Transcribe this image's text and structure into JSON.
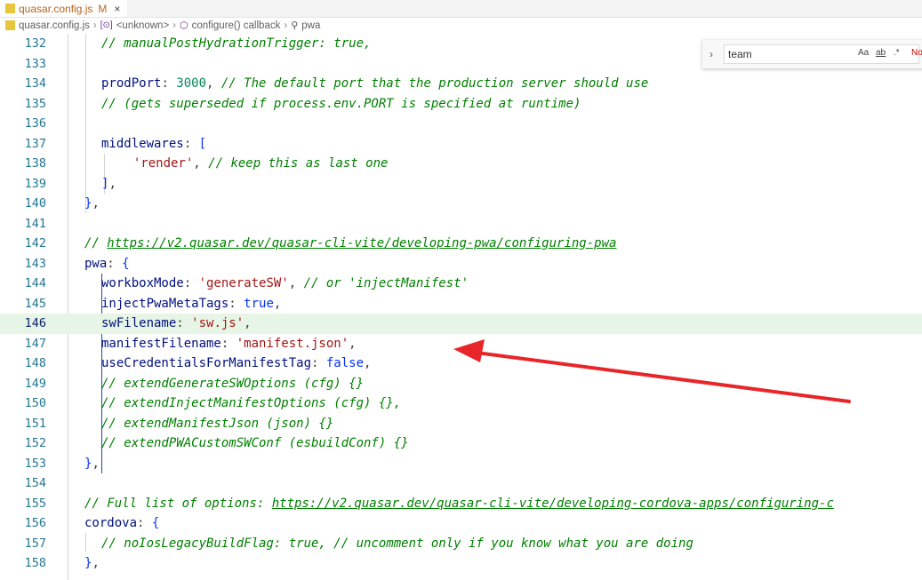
{
  "tab": {
    "filename": "quasar.config.js",
    "modified": "M",
    "close": "×"
  },
  "breadcrumb": {
    "items": [
      "quasar.config.js",
      "<unknown>",
      "configure() callback",
      "pwa"
    ]
  },
  "find": {
    "value": "team",
    "opt_case": "Aa",
    "opt_word": "ab",
    "opt_regex": ".*",
    "result": "No"
  },
  "lines": [
    {
      "n": "132",
      "tokens": [
        [
          "c",
          "// manualPostHydrationTrigger: true,"
        ]
      ]
    },
    {
      "n": "133",
      "tokens": []
    },
    {
      "n": "134",
      "tokens": [
        [
          "k",
          "prodPort"
        ],
        [
          "p",
          ": "
        ],
        [
          "n",
          "3000"
        ],
        [
          "p",
          ", "
        ],
        [
          "c",
          "// The default port that the production server should use"
        ]
      ]
    },
    {
      "n": "135",
      "tokens": [
        [
          "c",
          "// (gets superseded if process.env.PORT is specified at runtime)"
        ]
      ]
    },
    {
      "n": "136",
      "tokens": []
    },
    {
      "n": "137",
      "tokens": [
        [
          "k",
          "middlewares"
        ],
        [
          "p",
          ": "
        ],
        [
          "b",
          "["
        ]
      ]
    },
    {
      "n": "138",
      "tokens": [
        [
          "p",
          "  "
        ],
        [
          "s",
          "'render'"
        ],
        [
          "p",
          ", "
        ],
        [
          "c",
          "// keep this as last one"
        ]
      ]
    },
    {
      "n": "139",
      "tokens": [
        [
          "b",
          "]"
        ],
        [
          "p",
          ","
        ]
      ]
    },
    {
      "n": "140",
      "tokens": [
        [
          "b",
          "}"
        ],
        [
          "p",
          ","
        ]
      ]
    },
    {
      "n": "141",
      "tokens": []
    },
    {
      "n": "142",
      "tokens": [
        [
          "c",
          "// "
        ],
        [
          "cu",
          "https://v2.quasar.dev/quasar-cli-vite/developing-pwa/configuring-pwa"
        ]
      ]
    },
    {
      "n": "143",
      "tokens": [
        [
          "k",
          "pwa"
        ],
        [
          "p",
          ": "
        ],
        [
          "b",
          "{"
        ]
      ]
    },
    {
      "n": "144",
      "tokens": [
        [
          "k",
          "workboxMode"
        ],
        [
          "p",
          ": "
        ],
        [
          "s",
          "'generateSW'"
        ],
        [
          "p",
          ", "
        ],
        [
          "c",
          "// or 'injectManifest'"
        ]
      ]
    },
    {
      "n": "145",
      "tokens": [
        [
          "k",
          "injectPwaMetaTags"
        ],
        [
          "p",
          ": "
        ],
        [
          "b",
          "true"
        ],
        [
          "p",
          ","
        ]
      ]
    },
    {
      "n": "146",
      "tokens": [
        [
          "k",
          "swFilename"
        ],
        [
          "p",
          ": "
        ],
        [
          "s",
          "'sw.js'"
        ],
        [
          "p",
          ","
        ]
      ]
    },
    {
      "n": "147",
      "tokens": [
        [
          "k",
          "manifestFilename"
        ],
        [
          "p",
          ": "
        ],
        [
          "s",
          "'manifest.json'"
        ],
        [
          "p",
          ","
        ]
      ]
    },
    {
      "n": "148",
      "tokens": [
        [
          "k",
          "useCredentialsForManifestTag"
        ],
        [
          "p",
          ": "
        ],
        [
          "b",
          "false"
        ],
        [
          "p",
          ","
        ]
      ]
    },
    {
      "n": "149",
      "tokens": [
        [
          "c",
          "// extendGenerateSWOptions (cfg) {}"
        ]
      ]
    },
    {
      "n": "150",
      "tokens": [
        [
          "c",
          "// extendInjectManifestOptions (cfg) {},"
        ]
      ]
    },
    {
      "n": "151",
      "tokens": [
        [
          "c",
          "// extendManifestJson (json) {}"
        ]
      ]
    },
    {
      "n": "152",
      "tokens": [
        [
          "c",
          "// extendPWACustomSWConf (esbuildConf) {}"
        ]
      ]
    },
    {
      "n": "153",
      "tokens": [
        [
          "b",
          "}"
        ],
        [
          "p",
          ","
        ]
      ]
    },
    {
      "n": "154",
      "tokens": []
    },
    {
      "n": "155",
      "tokens": [
        [
          "c",
          "// Full list of options: "
        ],
        [
          "cu",
          "https://v2.quasar.dev/quasar-cli-vite/developing-cordova-apps/configuring-c"
        ]
      ]
    },
    {
      "n": "156",
      "tokens": [
        [
          "k",
          "cordova"
        ],
        [
          "p",
          ": "
        ],
        [
          "b",
          "{"
        ]
      ]
    },
    {
      "n": "157",
      "tokens": [
        [
          "c",
          "// noIosLegacyBuildFlag: true, // uncomment only if you know what you are doing"
        ]
      ]
    },
    {
      "n": "158",
      "tokens": [
        [
          "b",
          "}"
        ],
        [
          "p",
          ","
        ]
      ]
    }
  ]
}
